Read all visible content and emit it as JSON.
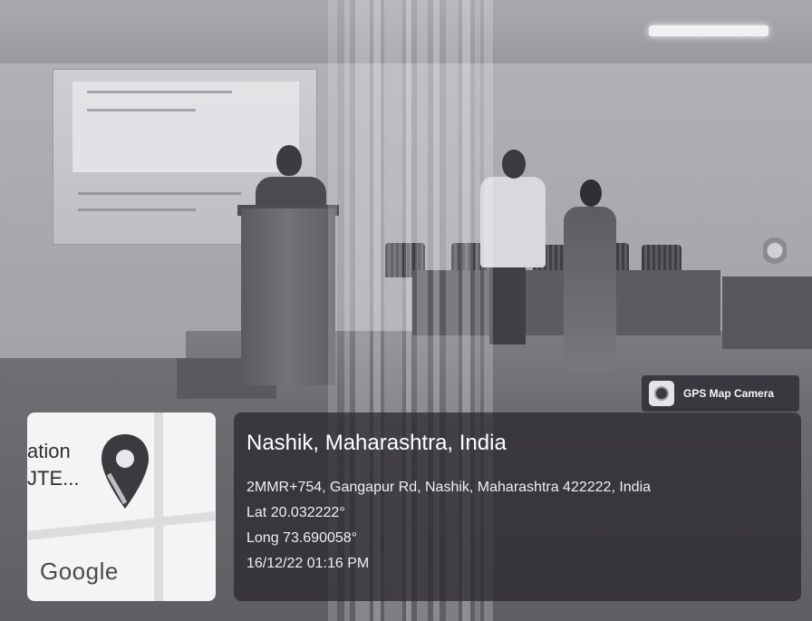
{
  "map_thumbnail": {
    "partial_text_line1": "ation",
    "partial_text_line2": "JTE...",
    "brand_text": "Google",
    "pin_color": "#3a3a3f"
  },
  "badge": {
    "label": "GPS Map Camera",
    "icon": "camera-icon"
  },
  "location": {
    "title": "Nashik, Maharashtra, India",
    "address": "2MMR+754, Gangapur Rd, Nashik, Maharashtra 422222, India",
    "latitude": "Lat 20.032222°",
    "longitude": "Long 73.690058°",
    "timestamp": "16/12/22 01:16 PM"
  }
}
